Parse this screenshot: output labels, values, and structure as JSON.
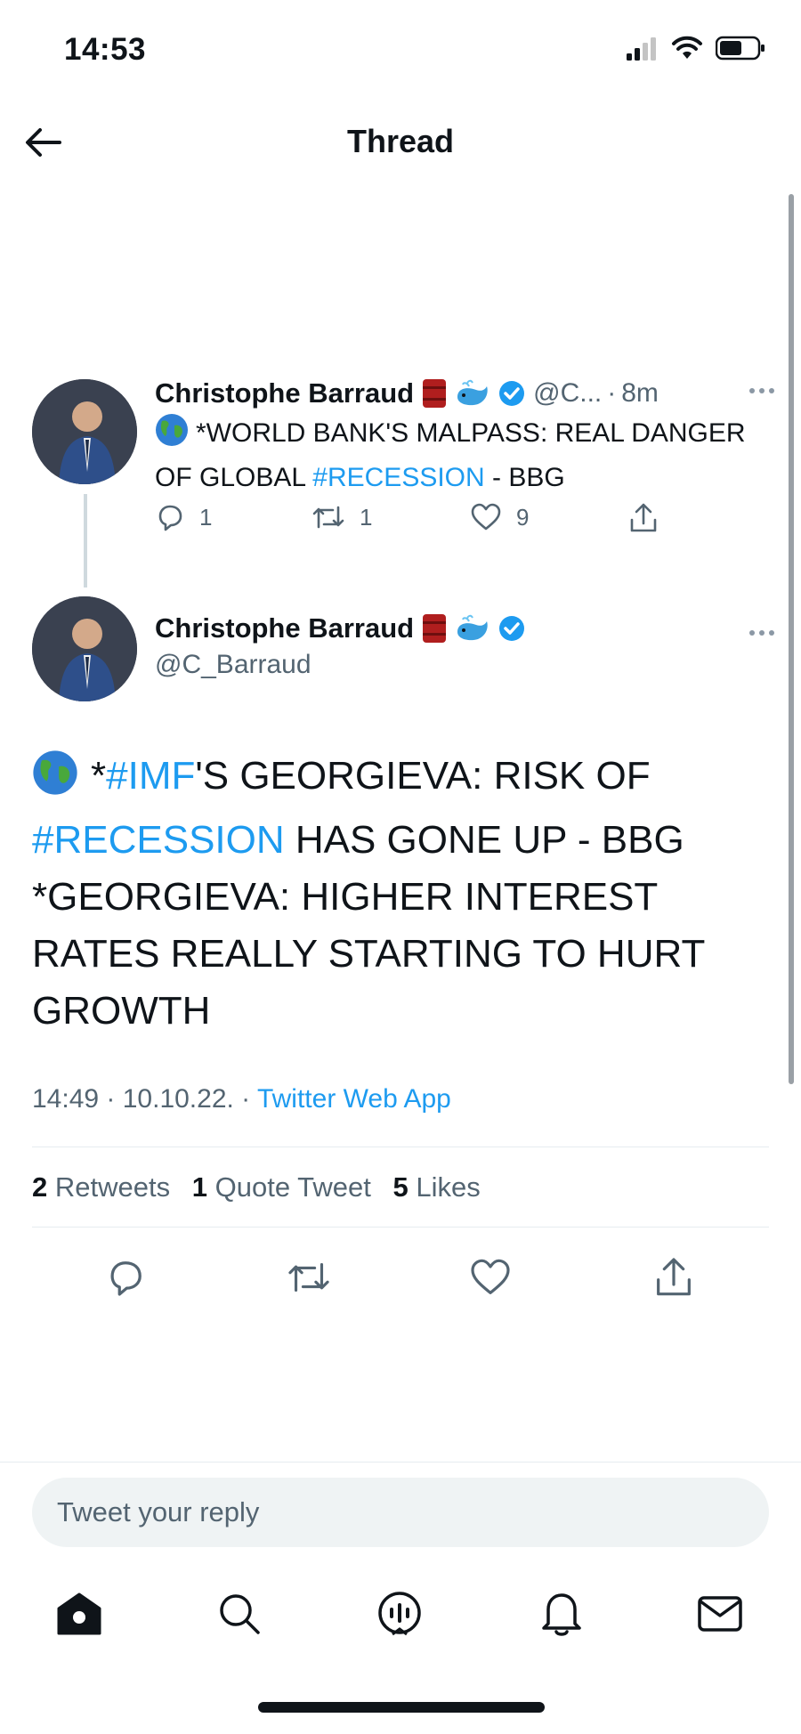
{
  "status_bar": {
    "time": "14:53"
  },
  "nav": {
    "title": "Thread"
  },
  "parent_tweet": {
    "author_name": "Christophe Barraud",
    "handle": "@C...",
    "time": "8m",
    "text_prefix": "*WORLD BANK'S MALPASS: REAL DANGER OF GLOBAL ",
    "hashtag": "#RECESSION",
    "text_suffix": " - BBG",
    "replies": "1",
    "retweets": "1",
    "likes": "9"
  },
  "main_tweet": {
    "author_name": "Christophe Barraud",
    "handle": "@C_Barraud",
    "text_star": "*",
    "hashtag_imf": "#IMF",
    "text_part1": "'S GEORGIEVA: RISK OF ",
    "hashtag_recession": "#RECESSION",
    "text_part2": " HAS GONE UP - BBG *GEORGIEVA: HIGHER INTEREST RATES REALLY STARTING TO HURT GROWTH",
    "timestamp": "14:49 · 10.10.22. · ",
    "source": "Twitter Web App",
    "stats": {
      "retweets_count": "2",
      "retweets_label": "Retweets",
      "quotes_count": "1",
      "quotes_label": "Quote Tweet",
      "likes_count": "5",
      "likes_label": "Likes"
    }
  },
  "reply": {
    "placeholder": "Tweet your reply"
  },
  "colors": {
    "link": "#1d9bf0",
    "muted": "#536471",
    "text": "#0f1419"
  }
}
